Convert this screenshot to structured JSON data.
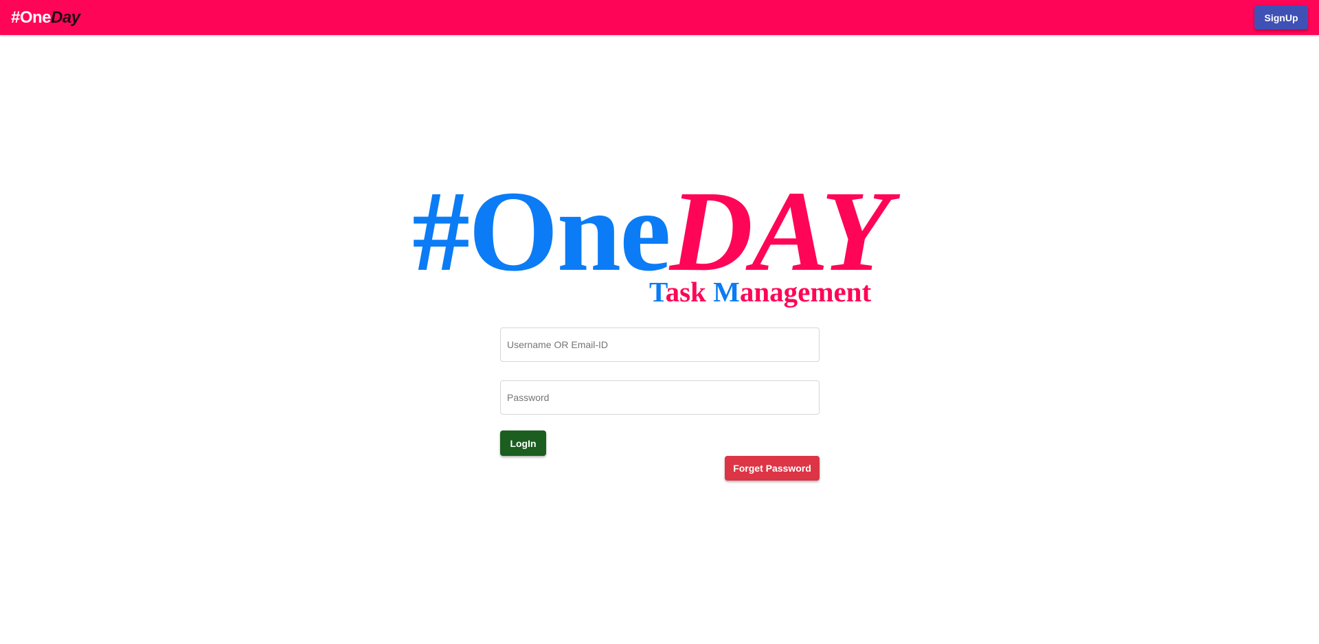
{
  "header": {
    "brand_part1": "#One",
    "brand_part2": "Day",
    "signup_label": "SignUp"
  },
  "logo": {
    "part_blue": "#One",
    "part_red": "DAY",
    "sub_t": "T",
    "sub_ask": "ask ",
    "sub_m": "M",
    "sub_anagement": "anagement"
  },
  "form": {
    "username_placeholder": "Username OR Email-ID",
    "password_placeholder": "Password",
    "login_label": "LogIn",
    "forget_label": "Forget Password"
  },
  "colors": {
    "header_bg": "#ff0557",
    "logo_blue": "#0b7cf5",
    "logo_red": "#ff0557",
    "signup_button": "#3f51b5",
    "login_button": "#1b5e20",
    "forget_button": "#dc3545"
  }
}
